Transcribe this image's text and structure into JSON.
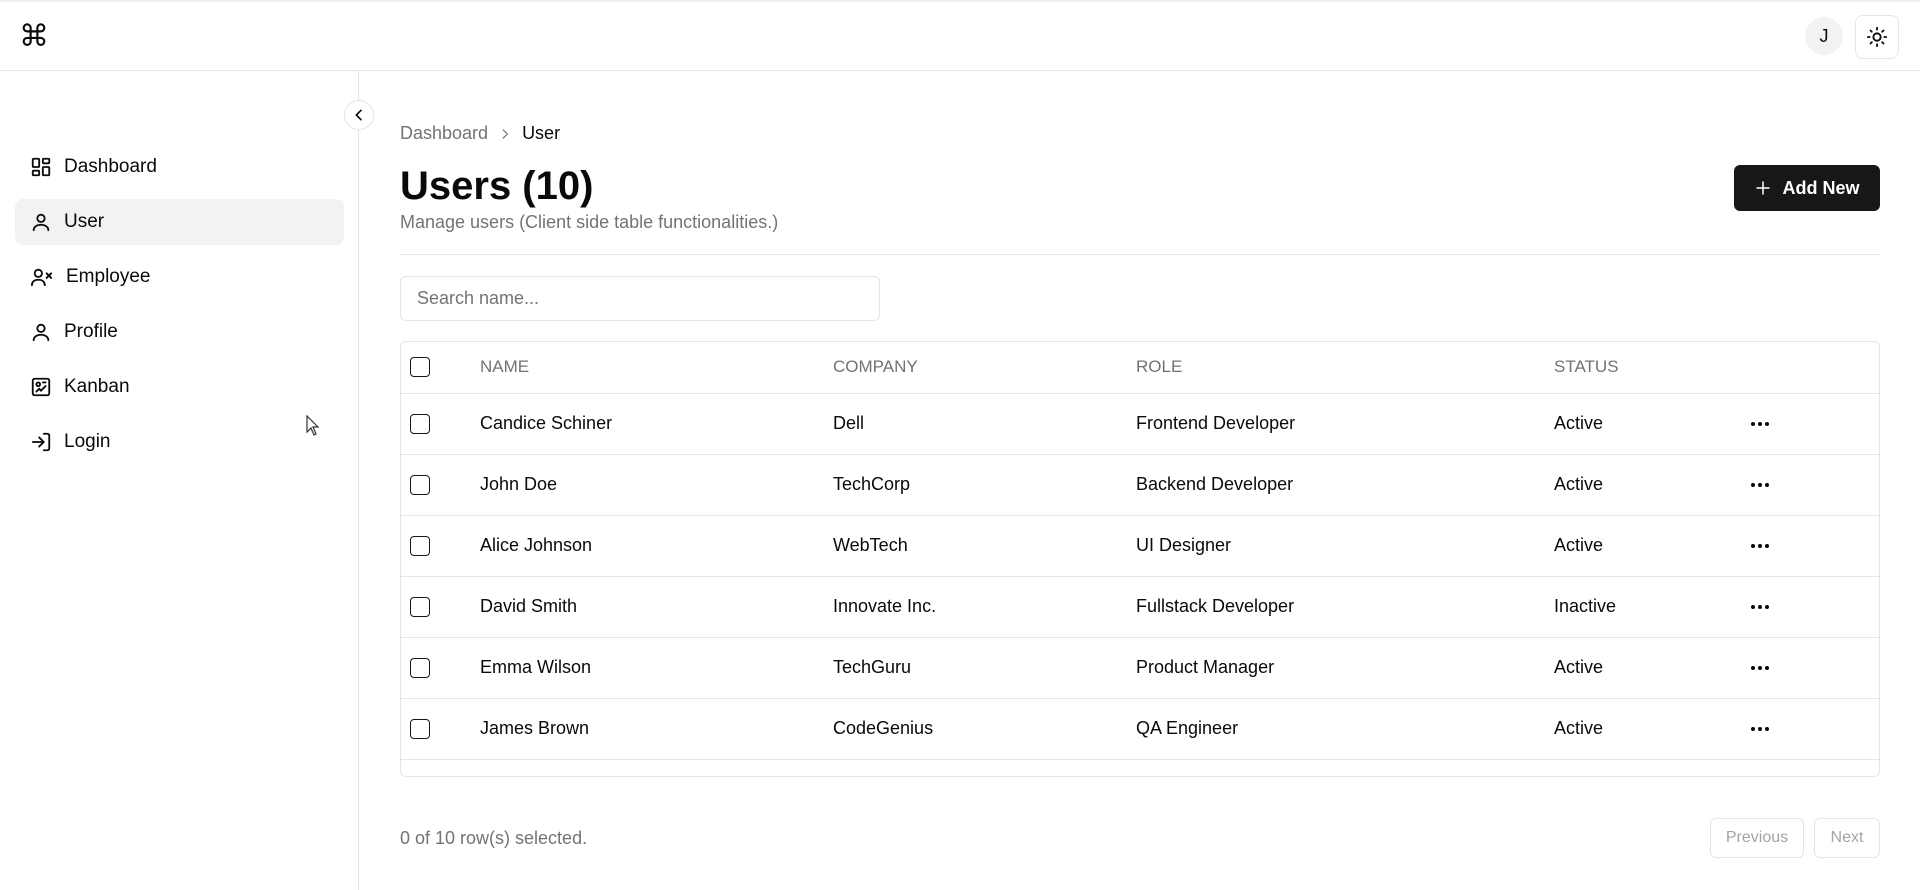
{
  "header": {
    "logo_glyph": "⌘",
    "avatar_initial": "J",
    "theme_icon": "sun-icon"
  },
  "sidebar": {
    "items": [
      {
        "label": "Dashboard",
        "icon": "dashboard-icon",
        "active": false
      },
      {
        "label": "User",
        "icon": "user-icon",
        "active": true
      },
      {
        "label": "Employee",
        "icon": "user-x-icon",
        "active": false
      },
      {
        "label": "Profile",
        "icon": "profile-icon",
        "active": false
      },
      {
        "label": "Kanban",
        "icon": "kanban-icon",
        "active": false
      },
      {
        "label": "Login",
        "icon": "login-icon",
        "active": false
      }
    ]
  },
  "breadcrumb": {
    "items": [
      "Dashboard",
      "User"
    ]
  },
  "page": {
    "title": "Users (10)",
    "description": "Manage users (Client side table functionalities.)",
    "add_label": "Add New"
  },
  "search": {
    "placeholder": "Search name...",
    "value": ""
  },
  "table": {
    "columns": [
      "NAME",
      "COMPANY",
      "ROLE",
      "STATUS"
    ],
    "rows": [
      {
        "name": "Candice Schiner",
        "company": "Dell",
        "role": "Frontend Developer",
        "status": "Active"
      },
      {
        "name": "John Doe",
        "company": "TechCorp",
        "role": "Backend Developer",
        "status": "Active"
      },
      {
        "name": "Alice Johnson",
        "company": "WebTech",
        "role": "UI Designer",
        "status": "Active"
      },
      {
        "name": "David Smith",
        "company": "Innovate Inc.",
        "role": "Fullstack Developer",
        "status": "Inactive"
      },
      {
        "name": "Emma Wilson",
        "company": "TechGuru",
        "role": "Product Manager",
        "status": "Active"
      },
      {
        "name": "James Brown",
        "company": "CodeGenius",
        "role": "QA Engineer",
        "status": "Active"
      }
    ]
  },
  "footer": {
    "selection_text": "0 of 10 row(s) selected.",
    "previous_label": "Previous",
    "next_label": "Next"
  },
  "colors": {
    "primary": "#171717",
    "muted_text": "#737373",
    "border": "#e5e5e5",
    "active_bg": "#f2f2f2"
  }
}
